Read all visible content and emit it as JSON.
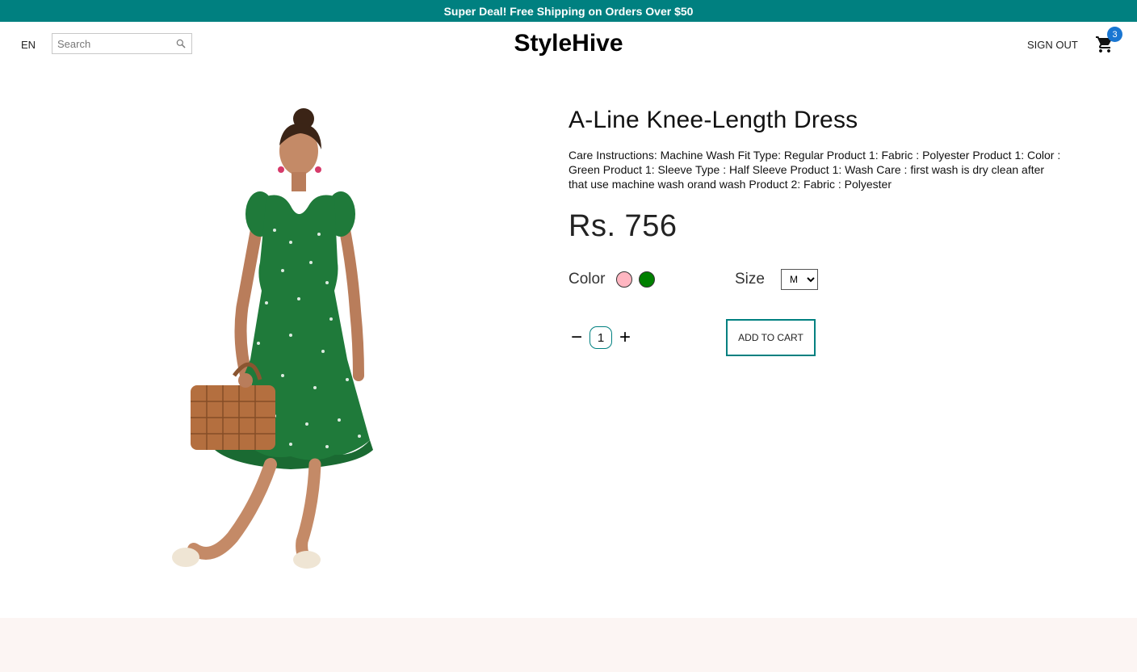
{
  "announcement": {
    "text": "Super Deal! Free Shipping on Orders Over $50"
  },
  "navbar": {
    "language": "EN",
    "search": {
      "placeholder": "Search",
      "icon": "search-icon"
    },
    "logo": "StyleHive",
    "sign_out_label": "SIGN OUT",
    "cart": {
      "icon": "shopping-cart-icon",
      "badge_count": "3"
    }
  },
  "product": {
    "image": {
      "subject": "woman in green polka dot dress holding wicker basket"
    },
    "title": "A-Line Knee-Length Dress",
    "description": "Care Instructions: Machine Wash Fit Type: Regular Product 1: Fabric : Polyester Product 1: Color : Green Product 1: Sleeve Type : Half Sleeve Product 1: Wash Care : first wash is dry clean after that use machine wash orand wash Product 2: Fabric : Polyester",
    "price": "Rs. 756",
    "color_label": "Color",
    "colors": [
      {
        "name": "pink",
        "hex": "#ffb6c1"
      },
      {
        "name": "green",
        "hex": "#008000"
      }
    ],
    "size_label": "Size",
    "size_selected": "M",
    "quantity": {
      "decrement_label": "−",
      "value": "1",
      "increment_label": "+"
    },
    "add_to_cart_label": "ADD TO CART"
  },
  "colors": {
    "accent": "#008080",
    "badge": "#1976d2",
    "footer_bg": "#fcf5f3"
  }
}
